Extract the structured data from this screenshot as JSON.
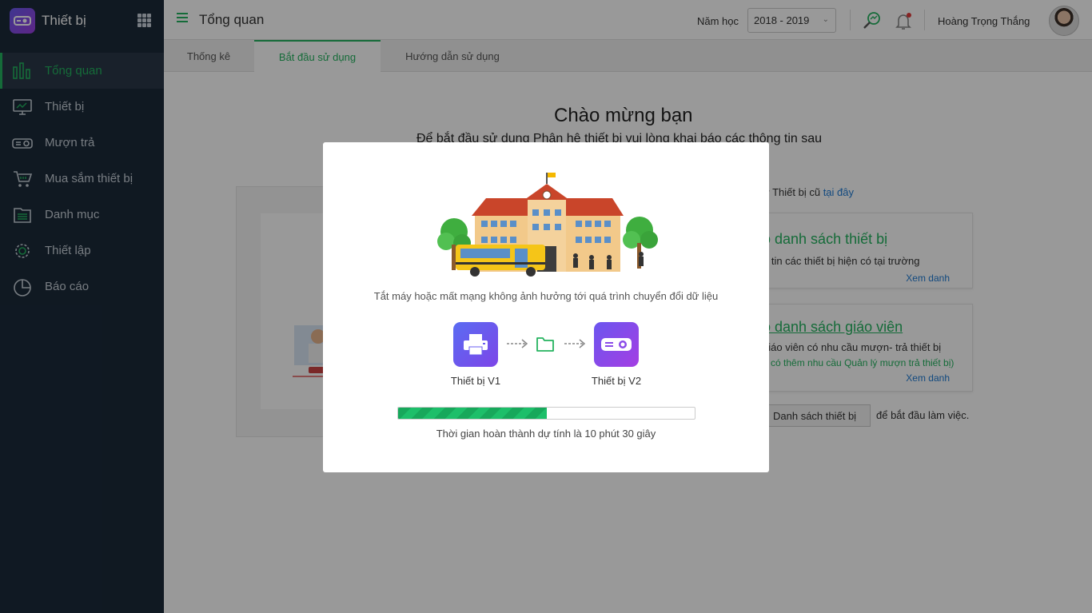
{
  "app": {
    "title": "Thiết bị"
  },
  "sidebar": {
    "items": [
      {
        "label": "Tổng quan",
        "icon": "bar-chart-icon",
        "active": true
      },
      {
        "label": "Thiết bị",
        "icon": "monitor-icon"
      },
      {
        "label": "Mượn trả",
        "icon": "projector-icon"
      },
      {
        "label": "Mua sắm thiết bị",
        "icon": "cart-icon"
      },
      {
        "label": "Danh mục",
        "icon": "list-icon"
      },
      {
        "label": "Thiết lập",
        "icon": "gear-icon"
      },
      {
        "label": "Báo cáo",
        "icon": "pie-chart-icon"
      }
    ]
  },
  "header": {
    "title": "Tổng quan",
    "year_label": "Năm học",
    "year_value": "2018 - 2019",
    "user_name": "Hoàng Trọng  Thắng"
  },
  "tabs": [
    {
      "label": "Thống kê"
    },
    {
      "label": "Bắt đầu sử dụng",
      "active": true
    },
    {
      "label": "Hướng dẫn sử dụng"
    }
  ],
  "main": {
    "welcome_title": "Chào mừng bạn",
    "welcome_sub": "Để bắt đầu sử dụng Phân hệ thiết bị vui lòng khai báo các thông tin sau",
    "note_prefix": "ư Thiết bị cũ",
    "note_link": "tại đây",
    "card1": {
      "title": "o danh sách thiết bị",
      "desc": "g tin các thiết bị hiện có tại trường",
      "link": "Xem danh"
    },
    "card2": {
      "title": "o danh sách giáo viên",
      "desc": "giáo viên có nhu cầu mượn- trả thiết bị",
      "note": "g có thêm nhu cầu Quản lý mượn trả thiết bị)",
      "link": "Xem danh"
    },
    "button_label": "Danh sách thiết bị",
    "after_button": "để bắt đầu làm việc."
  },
  "modal": {
    "message": "Tắt máy hoặc mất mạng không ảnh hưởng tới quá trình chuyển đổi dữ liệu",
    "source_label": "Thiết bị V1",
    "target_label": "Thiết bị V2",
    "progress_percent": 50,
    "eta": "Thời gian hoàn thành dự tính là 10 phút 30 giây"
  },
  "colors": {
    "accent": "#24b35f",
    "sidebar_bg": "#1b2a3a",
    "link": "#1e7bd4"
  }
}
